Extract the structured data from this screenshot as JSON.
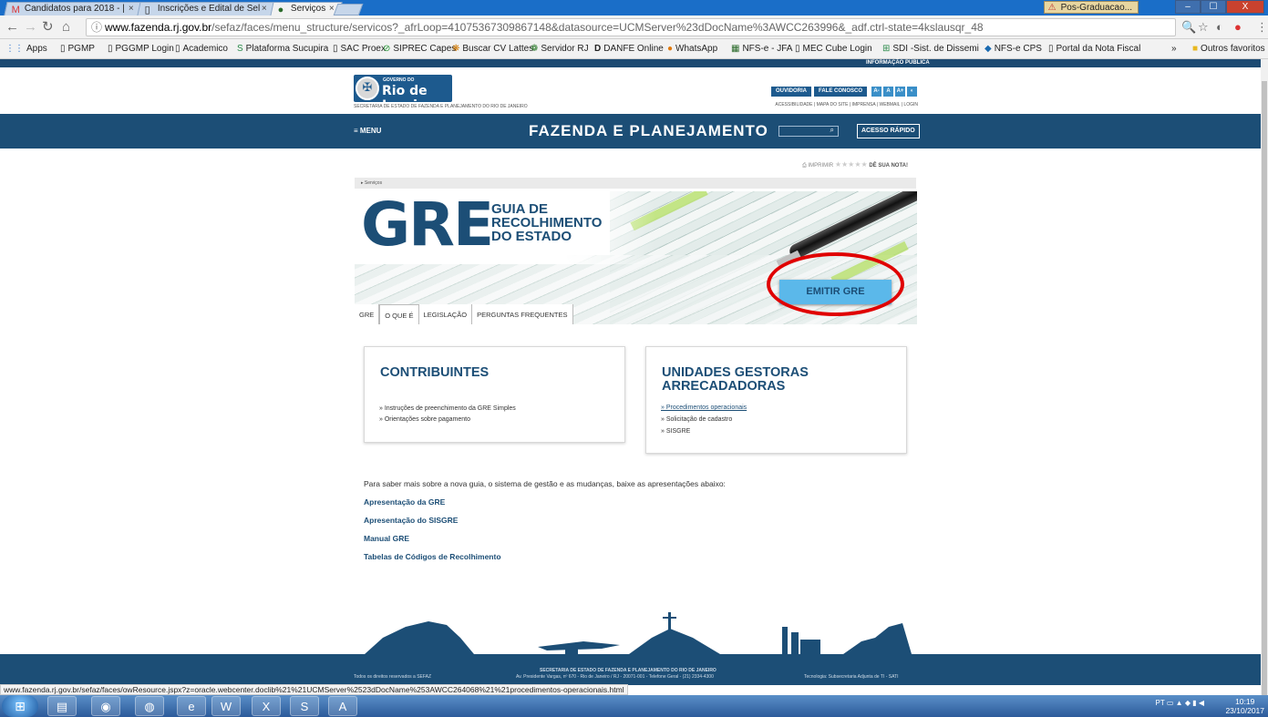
{
  "browser": {
    "tabs": [
      {
        "title": "Candidatos para 2018 - | ",
        "icon": "gmail-icon"
      },
      {
        "title": "Inscrições e Edital de Sel",
        "icon": "page-icon"
      },
      {
        "title": "Serviços",
        "icon": "site-icon",
        "active": true
      }
    ],
    "tab_close": "×",
    "profile_label": "Pos-Graduacao...",
    "window_controls": [
      "–",
      "☐",
      "X"
    ],
    "url_host": "www.fazenda.rj.gov.br",
    "url_path": "/sefaz/faces/menu_structure/servicos?_afrLoop=41075367309867148&datasource=UCMServer%23dDocName%3AWCC263996&_adf.ctrl-state=4kslausqr_48",
    "bookmarks": [
      "Apps",
      "PGMP",
      "PGGMP Login",
      "Academico",
      "Plataforma Sucupira",
      "SAC Proex",
      "SIPREC Capes",
      "Buscar CV Lattes",
      "Servidor RJ",
      "DANFE Online",
      "WhatsApp",
      "NFS-e - JFA",
      "MEC Cube Login",
      "SDI -Sist. de Dissemi",
      "NFS-e CPS",
      "Portal da Nota Fiscal"
    ],
    "bookmarks_more": "»",
    "other_bookmarks": "Outros favoritos",
    "status_url": "www.fazenda.rj.gov.br/sefaz/faces/owResource.jspx?z=oracle.webcenter.doclib%21%21UCMServer%2523dDocName%253AWCC264068%21%21procedimentos-operacionais.html"
  },
  "header": {
    "info_publica": "INFORMAÇÃO PÚBLICA",
    "gov_do": "GOVERNO DO",
    "rio": "Rio de Janeiro",
    "secretaria": "SECRETARIA DE ESTADO DE FAZENDA E PLANEJAMENTO DO RIO DE JANEIRO",
    "ouvidoria": "OUVIDORIA",
    "fale": "FALE CONOSCO",
    "font_buttons": [
      "A-",
      "A",
      "A+",
      "◐"
    ],
    "links": "ACESSIBILIDADE | MAPA DO SITE | IMPRENSA | WEBMAIL | LOGIN"
  },
  "nav": {
    "menu": "≡ MENU",
    "title": "FAZENDA E PLANEJAMENTO",
    "search_icon": "🔍",
    "acesso": "ACESSO RÁPIDO"
  },
  "rating": {
    "imprimir": "IMPRIMIR",
    "stars": "★★★★★",
    "label": "DÊ SUA NOTA!"
  },
  "breadcrumb": "▸ Serviços",
  "banner": {
    "gre": "GRE",
    "sub1": "GUIA DE",
    "sub2": "RECOLHIMENTO",
    "sub3": "DO ESTADO",
    "emitir": "EMITIR GRE",
    "tabs": [
      "GRE",
      "O QUE É",
      "LEGISLAÇÃO",
      "PERGUNTAS FREQUENTES"
    ]
  },
  "contribuintes": {
    "title": "CONTRIBUINTES",
    "links": [
      "» Instruções de preenchimento da GRE Simples",
      "» Orientações sobre pagamento"
    ]
  },
  "unidades": {
    "title1": "UNIDADES GESTORAS",
    "title2": "ARRECADADORAS",
    "links": [
      "» Procedimentos operacionais",
      "» Solicitação de cadastro",
      "» SISGRE"
    ]
  },
  "intro": "Para saber mais sobre a nova guia, o sistema de gestão e as mudanças, baixe as apresentações abaixo:",
  "downloads": [
    "Apresentação da GRE",
    "Apresentação do SISGRE",
    "Manual GRE",
    "Tabelas de Códigos de Recolhimento"
  ],
  "footer": {
    "rights": "Todos os direitos reservados a SEFAZ",
    "sec": "SECRETARIA DE ESTADO DE FAZENDA E PLANEJAMENTO DO RIO DE JANEIRO",
    "addr": "Av. Presidente Vargas, nº 670 - Rio de Janeiro / RJ - 20071-001 - Telefone Geral - (21) 2334-4300",
    "tech": "Tecnologia: Subsecretaria Adjunta de TI - SATI"
  },
  "taskbar": {
    "lang": "PT",
    "time": "10:19",
    "date": "23/10/2017"
  },
  "colors": {
    "brand_blue": "#1c4e76",
    "emitir": "#5bb8ea",
    "highlight": "#e00000"
  }
}
